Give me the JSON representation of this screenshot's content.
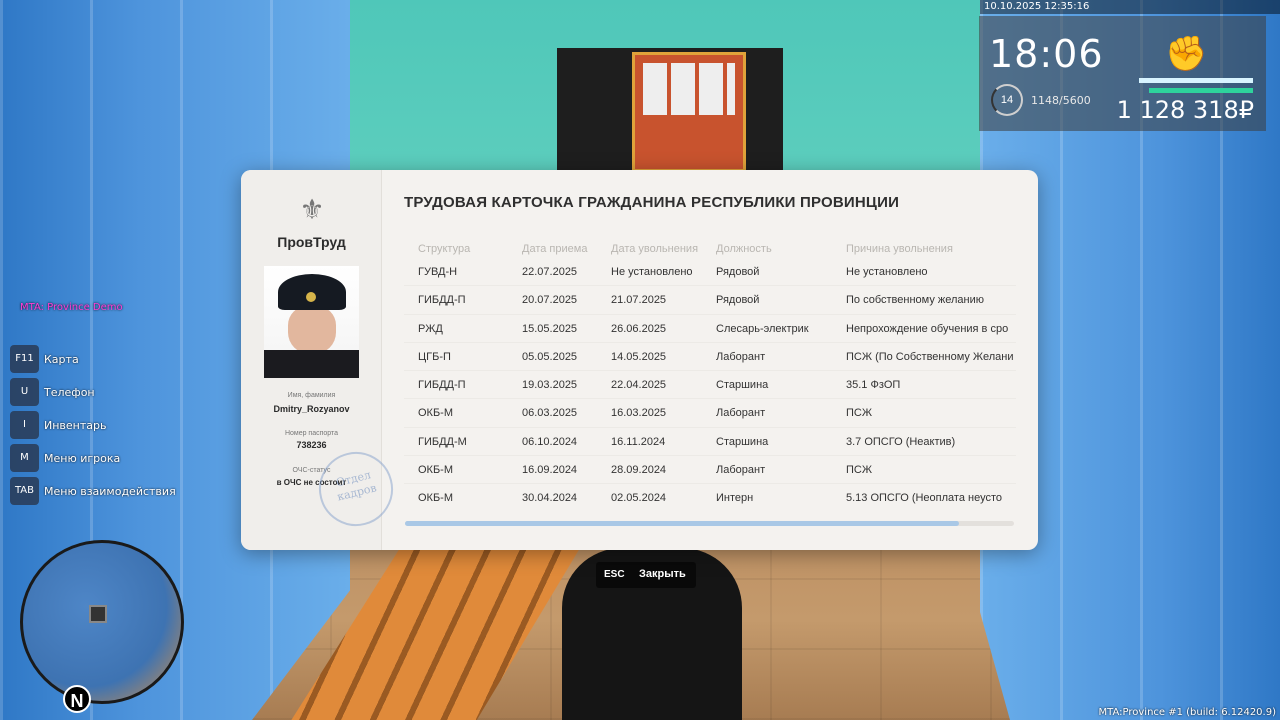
{
  "hud": {
    "datetime": "10.10.2025 12:35:16",
    "clock": "18:06",
    "level": "14",
    "exp": "1148/5600",
    "money": "1 128 318₽",
    "server_name": "MTA: Province Demo",
    "build": "MTA:Province #1 (build: 6.12420.9)"
  },
  "hotkeys": [
    {
      "key": "F11",
      "label": "Карта"
    },
    {
      "key": "U",
      "label": "Телефон"
    },
    {
      "key": "I",
      "label": "Инвентарь"
    },
    {
      "key": "M",
      "label": "Меню игрока"
    },
    {
      "key": "TAB",
      "label": "Меню взаимодействия"
    }
  ],
  "minimap": {
    "north": "N"
  },
  "card": {
    "org_name": "ПровТруд",
    "title": "ТРУДОВАЯ КАРТОЧКА ГРАЖДАНИНА РЕСПУБЛИКИ ПРОВИНЦИИ",
    "name_caption": "Имя, фамилия",
    "name": "Dmitry_Rozyanov",
    "passport_caption": "Номер паспорта",
    "passport": "738236",
    "status_caption": "ОЧС-статус",
    "status": "в ОЧС не состоит",
    "stamp_line1": "Отдел",
    "stamp_line2": "кадров",
    "columns": [
      "Структура",
      "Дата приема",
      "Дата увольнения",
      "Должность",
      "Причина увольнения"
    ],
    "rows": [
      [
        "ГУВД-Н",
        "22.07.2025",
        "Не установлено",
        "Рядовой",
        "Не установлено"
      ],
      [
        "ГИБДД-П",
        "20.07.2025",
        "21.07.2025",
        "Рядовой",
        "По собственному желанию"
      ],
      [
        "РЖД",
        "15.05.2025",
        "26.06.2025",
        "Слесарь-электрик",
        "Непрохождение обучения в сро"
      ],
      [
        "ЦГБ-П",
        "05.05.2025",
        "14.05.2025",
        "Лаборант",
        "ПСЖ (По Собственному Желани"
      ],
      [
        "ГИБДД-П",
        "19.03.2025",
        "22.04.2025",
        "Старшина",
        "35.1 ФзОП"
      ],
      [
        "ОКБ-М",
        "06.03.2025",
        "16.03.2025",
        "Лаборант",
        "ПСЖ"
      ],
      [
        "ГИБДД-М",
        "06.10.2024",
        "16.11.2024",
        "Старшина",
        "3.7 ОПСГО (Неактив)"
      ],
      [
        "ОКБ-М",
        "16.09.2024",
        "28.09.2024",
        "Лаборант",
        "ПСЖ"
      ],
      [
        "ОКБ-М",
        "30.04.2024",
        "02.05.2024",
        "Интерн",
        "5.13 ОПСГО (Неоплата неусто"
      ]
    ],
    "scroll_fraction": 0.91
  },
  "footer": {
    "esc_key": "ESC",
    "esc_label": "Закрыть"
  },
  "colors": {
    "accent_scroll": "#a9c8e6",
    "hud_exp_bar": "#2ed39c",
    "server_name": "#ff3bd5"
  }
}
